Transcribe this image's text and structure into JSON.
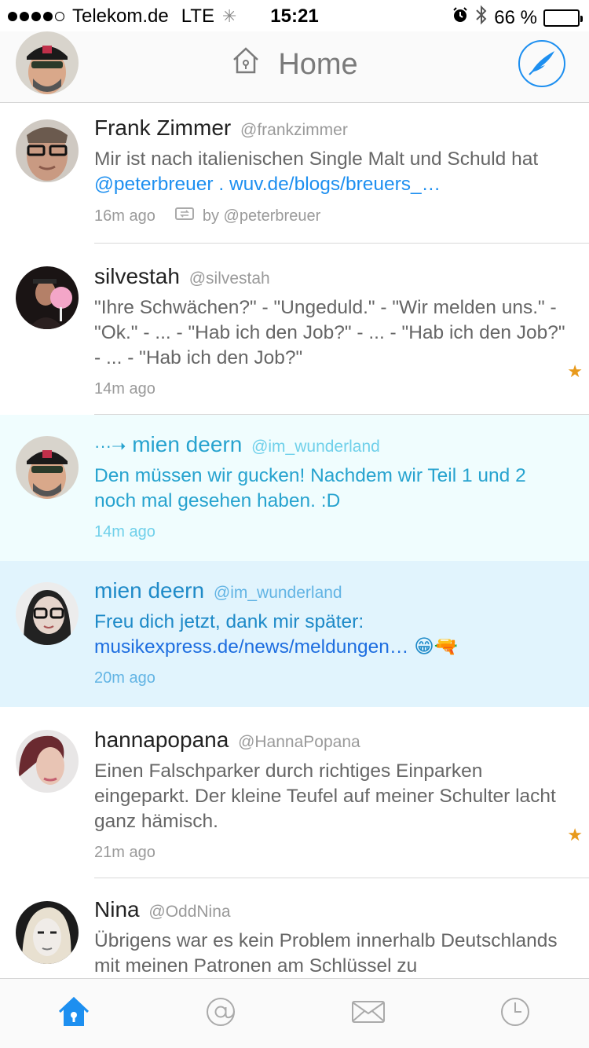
{
  "status_bar": {
    "carrier": "Telekom.de",
    "network": "LTE",
    "time": "15:21",
    "battery": "66 %",
    "battery_level": 0.66,
    "signal_bars": 4,
    "signal_total": 5
  },
  "nav": {
    "title": "Home"
  },
  "colors": {
    "accent": "#1d8ff0",
    "star": "#e89a1c",
    "mention_bg": "#f0fdfe",
    "dm_bg": "#e1f4fd"
  },
  "tweets": [
    {
      "name": "Frank Zimmer",
      "handle": "@frankzimmer",
      "text_plain": "Mir ist nach italienischen Single Malt und Schuld hat",
      "text_link1": "@peterbreuer",
      "text_mid": " . ",
      "text_link2": "wuv.de/blogs/breuers_…",
      "time": "16m ago",
      "retweet_icon": "retweet-icon",
      "retweet_by": "by @peterbreuer"
    },
    {
      "name": "silvestah",
      "handle": "@silvestah",
      "text": "\"Ihre Schwächen?\" - \"Ungeduld.\" - \"Wir melden uns.\" - \"Ok.\" - ... - \"Hab ich den Job?\" - ... - \"Hab ich den Job?\" - ... - \"Hab ich den Job?\"",
      "time": "14m ago",
      "starred": true
    },
    {
      "name": "mien deern",
      "handle": "@im_wunderland",
      "prefix": "···➝",
      "text": "Den müssen wir gucken! Nachdem wir Teil 1 und 2 noch mal gesehen haben. :D",
      "time": "14m ago"
    },
    {
      "name": "mien deern",
      "handle": "@im_wunderland",
      "text_plain": "Freu dich jetzt, dank mir später: ",
      "text_link": "musikexpress.de/news/meldungen…",
      "emoji": "😁🔫",
      "time": "20m ago"
    },
    {
      "name": "hannapopana",
      "handle": "@HannaPopana",
      "text": "Einen Falschparker durch richtiges Einparken eingeparkt. Der kleine Teufel auf meiner Schulter lacht ganz hämisch.",
      "time": "21m ago",
      "starred": true
    },
    {
      "name": "Nina",
      "handle": "@OddNina",
      "text": "Übrigens war es kein Problem innerhalb Deutschlands mit meinen Patronen am Schlüssel zu"
    }
  ],
  "tabs": [
    {
      "icon": "home-icon",
      "active": true
    },
    {
      "icon": "at-icon",
      "active": false
    },
    {
      "icon": "mail-icon",
      "active": false
    },
    {
      "icon": "clock-icon",
      "active": false
    }
  ]
}
